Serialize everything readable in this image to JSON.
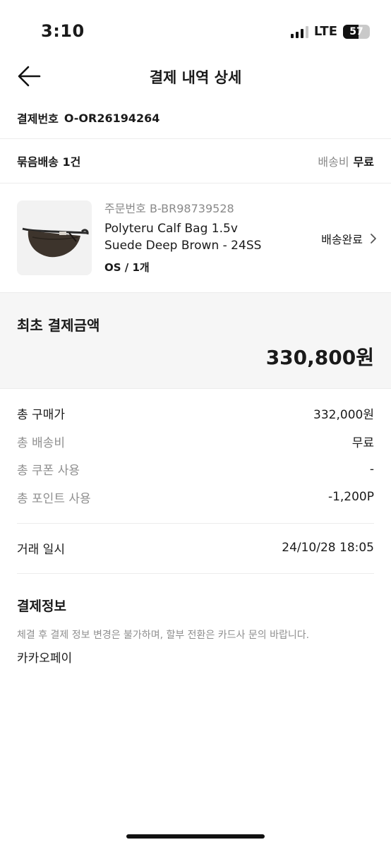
{
  "status_bar": {
    "time": "3:10",
    "network": "LTE",
    "battery": "57",
    "battery_level": 0.57
  },
  "header": {
    "title": "결제 내역 상세",
    "back_icon": "arrow-left-icon"
  },
  "order": {
    "label": "결제번호",
    "number": "O-OR26194264"
  },
  "bundle": {
    "label": "묶음배송 1건",
    "shipping_fee_label": "배송비",
    "shipping_fee_value": "무료"
  },
  "product": {
    "order_number": "주문번호 B-BR98739528",
    "name_line1": "Polyteru Calf Bag 1.5v",
    "name_line2": "Suede Deep Brown - 24SS",
    "option": "OS / 1개",
    "status": "배송완료",
    "status_icon": "chevron-right-icon"
  },
  "first_payment": {
    "label": "최초 결제금액",
    "amount": "330,800원"
  },
  "line_items": [
    {
      "label": "총 구매가",
      "value": "332,000원",
      "muted": false
    },
    {
      "label": "총 배송비",
      "value": "무료",
      "muted": true
    },
    {
      "label": "총 쿠폰 사용",
      "value": "-",
      "muted": true
    },
    {
      "label": "총 포인트 사용",
      "value": "-1,200P",
      "muted": true
    }
  ],
  "trade": {
    "label": "거래 일시",
    "value": "24/10/28 18:05"
  },
  "payment_info": {
    "title": "결제정보",
    "note": "체결 후 결제 정보 변경은 불가하며, 할부 전환은 카드사 문의 바랍니다.",
    "method": "카카오페이"
  }
}
